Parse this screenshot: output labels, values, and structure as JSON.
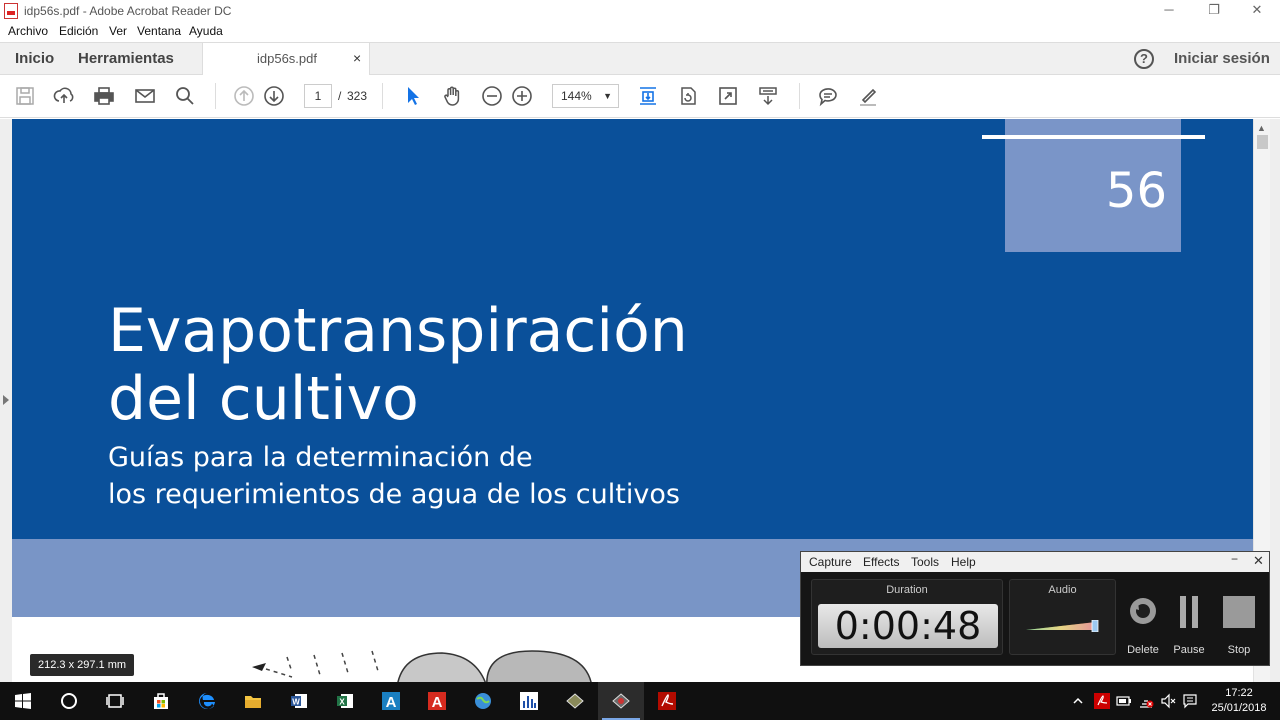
{
  "window": {
    "title": "idp56s.pdf - Adobe Acrobat Reader DC",
    "controls": {
      "minimize": "─",
      "restore": "❐",
      "close": "✕"
    }
  },
  "menu": [
    "Archivo",
    "Edición",
    "Ver",
    "Ventana",
    "Ayuda"
  ],
  "tabs": {
    "home": "Inicio",
    "tools": "Herramientas",
    "document": "idp56s.pdf",
    "close_glyph": "×",
    "help_glyph": "?",
    "signin": "Iniciar sesión"
  },
  "toolbar": {
    "icons": [
      "save-icon",
      "upload-icon",
      "print-icon",
      "email-icon",
      "search-icon",
      "page-up-icon",
      "page-down-icon",
      "select-pointer-icon",
      "hand-icon",
      "zoom-out-icon",
      "zoom-in-icon",
      "fit-page-icon",
      "rotate-icon",
      "full-screen-icon",
      "read-mode-icon",
      "comment-icon",
      "highlight-pen-icon"
    ],
    "current_page": "1",
    "page_separator": "/",
    "total_pages": "323",
    "zoom": "144%",
    "zoom_caret": "▼"
  },
  "document": {
    "number": "56",
    "title_line1": "Evapotranspiración",
    "title_line2": "del cultivo",
    "subtitle_line1": "Guías para la determinación de",
    "subtitle_line2": "los requerimientos de agua de los cultivos",
    "page_size": "212.3 x 297.1 mm",
    "colors": {
      "cover_blue": "#0a509a",
      "cover_light": "#7995c6",
      "number_box": "#7a95c8"
    }
  },
  "recorder": {
    "menu": [
      "Capture",
      "Effects",
      "Tools",
      "Help"
    ],
    "minimize": "−",
    "close": "✕",
    "duration_label": "Duration",
    "duration": "0:00:48",
    "audio_label": "Audio",
    "buttons": {
      "delete": "Delete",
      "pause": "Pause",
      "stop": "Stop"
    }
  },
  "taskbar": {
    "apps": [
      "windows-start-icon",
      "cortana-icon",
      "task-view-icon",
      "store-icon",
      "edge-icon",
      "file-explorer-icon",
      "word-icon",
      "excel-icon",
      "autocad-icon",
      "acrobat-icon",
      "globe-icon",
      "chart-app-icon",
      "image-app-icon",
      "camtasia-recorder-icon",
      "acrobat-reader-icon"
    ],
    "time": "17:22",
    "date": "25/01/2018"
  }
}
